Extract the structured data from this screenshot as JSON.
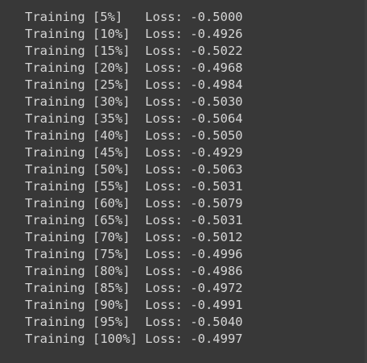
{
  "output": {
    "lines": [
      "Training [5%]   Loss: -0.5000",
      "Training [10%]  Loss: -0.4926",
      "Training [15%]  Loss: -0.5022",
      "Training [20%]  Loss: -0.4968",
      "Training [25%]  Loss: -0.4984",
      "Training [30%]  Loss: -0.5030",
      "Training [35%]  Loss: -0.5064",
      "Training [40%]  Loss: -0.5050",
      "Training [45%]  Loss: -0.4929",
      "Training [50%]  Loss: -0.5063",
      "Training [55%]  Loss: -0.5031",
      "Training [60%]  Loss: -0.5079",
      "Training [65%]  Loss: -0.5031",
      "Training [70%]  Loss: -0.5012",
      "Training [75%]  Loss: -0.4996",
      "Training [80%]  Loss: -0.4986",
      "Training [85%]  Loss: -0.4972",
      "Training [90%]  Loss: -0.4991",
      "Training [95%]  Loss: -0.5040",
      "Training [100%] Loss: -0.4997"
    ]
  },
  "colors": {
    "background": "#383838",
    "text": "#d5d5d5"
  }
}
